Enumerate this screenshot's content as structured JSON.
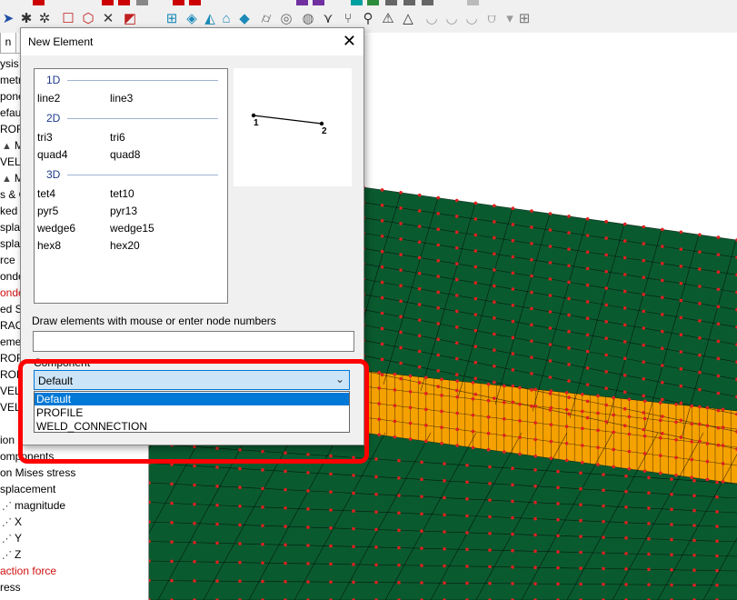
{
  "tree": {
    "tab_label": "n",
    "rows": [
      {
        "text": "ysis ◂",
        "red": false,
        "icon": ""
      },
      {
        "text": "metry",
        "red": false,
        "icon": ""
      },
      {
        "text": "pone",
        "red": false,
        "icon": ""
      },
      {
        "text": "efau",
        "red": false,
        "icon": ""
      },
      {
        "text": "ROF",
        "red": false,
        "icon": ""
      },
      {
        "text": "Ma",
        "red": false,
        "icon": "▲"
      },
      {
        "text": "VELD",
        "red": false,
        "icon": ""
      },
      {
        "text": "Ma",
        "red": false,
        "icon": "▲"
      },
      {
        "text": "s & C",
        "red": false,
        "icon": ""
      },
      {
        "text": "ked s",
        "red": false,
        "icon": ""
      },
      {
        "text": "spla",
        "red": false,
        "icon": ""
      },
      {
        "text": "spla",
        "red": false,
        "icon": ""
      },
      {
        "text": "rce",
        "red": false,
        "icon": ""
      },
      {
        "text": "onde",
        "red": false,
        "icon": ""
      },
      {
        "text": "onde",
        "red": true,
        "icon": ""
      },
      {
        "text": "ed Se",
        "red": false,
        "icon": ""
      },
      {
        "text": "RAC",
        "red": false,
        "icon": ""
      },
      {
        "text": "eme",
        "red": false,
        "icon": ""
      },
      {
        "text": "ROF",
        "red": false,
        "icon": ""
      },
      {
        "text": "ROF",
        "red": false,
        "icon": ""
      },
      {
        "text": "VELD",
        "red": false,
        "icon": ""
      },
      {
        "text": "VELD",
        "red": false,
        "icon": ""
      },
      {
        "text": "",
        "red": false,
        "icon": ""
      },
      {
        "text": "ion",
        "red": false,
        "icon": ""
      },
      {
        "text": "omponents",
        "red": false,
        "icon": ""
      },
      {
        "text": "on Mises stress",
        "red": false,
        "icon": ""
      },
      {
        "text": "splacement",
        "red": false,
        "icon": ""
      },
      {
        "text": "magnitude",
        "red": false,
        "icon": "⋰"
      },
      {
        "text": "X",
        "red": false,
        "icon": "⋰"
      },
      {
        "text": "Y",
        "red": false,
        "icon": "⋰"
      },
      {
        "text": "Z",
        "red": false,
        "icon": "⋰"
      },
      {
        "text": "action force",
        "red": true,
        "icon": ""
      },
      {
        "text": "ress",
        "red": false,
        "icon": ""
      }
    ]
  },
  "dialog": {
    "title": "New Element",
    "close_glyph": "✕",
    "groups": [
      {
        "label": "1D",
        "items": [
          [
            "line2",
            "line3"
          ]
        ]
      },
      {
        "label": "2D",
        "items": [
          [
            "tri3",
            "tri6"
          ],
          [
            "quad4",
            "quad8"
          ]
        ]
      },
      {
        "label": "3D",
        "items": [
          [
            "tet4",
            "tet10"
          ],
          [
            "pyr5",
            "pyr13"
          ],
          [
            "wedge6",
            "wedge15"
          ],
          [
            "hex8",
            "hex20"
          ]
        ]
      }
    ],
    "preview": {
      "node1": "1",
      "node2": "2"
    },
    "hint": "Draw elements with mouse or enter node numbers",
    "node_input_value": "",
    "component_label": "Component",
    "component_selected": "Default",
    "component_options": [
      "Default",
      "PROFILE",
      "WELD_CONNECTION"
    ]
  },
  "colors": {
    "mesh_green": "#0a5a2f",
    "weld_orange": "#f5a100",
    "node_red": "#e02020",
    "highlight": "#ff0000",
    "selection_blue": "#0078d7"
  }
}
